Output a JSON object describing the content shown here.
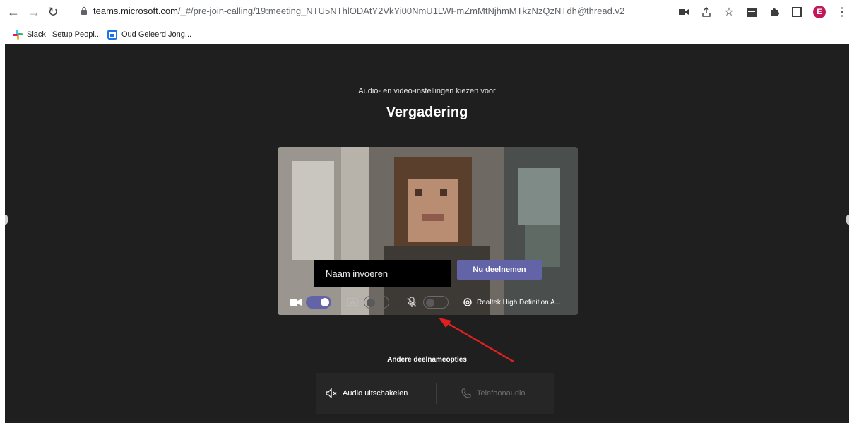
{
  "browser": {
    "url_host": "teams.microsoft.com",
    "url_path": "/_#/pre-join-calling/19:meeting_NTU5NThlODAtY2VkYi00NmU1LWFmZmMtNjhmMTkzNzQzNTdh@thread.v2",
    "avatar_initial": "E",
    "bookmarks": [
      {
        "label": "Slack | Setup Peopl..."
      },
      {
        "label": "Oud Geleerd Jong..."
      }
    ]
  },
  "prejoin": {
    "subtitle": "Audio- en video-instellingen kiezen voor",
    "title": "Vergadering",
    "name_placeholder": "Naam invoeren",
    "join_label": "Nu deelnemen",
    "camera_on": true,
    "background_effects_on": false,
    "mic_on": false,
    "audio_device": "Realtek High Definition A..."
  },
  "other": {
    "title": "Andere deelnameopties",
    "audio_off_label": "Audio uitschakelen",
    "phone_audio_label": "Telefoonaudio"
  },
  "colors": {
    "accent": "#6264a7",
    "page_bg": "#1f1f1f",
    "annotation_arrow": "#e02020"
  }
}
